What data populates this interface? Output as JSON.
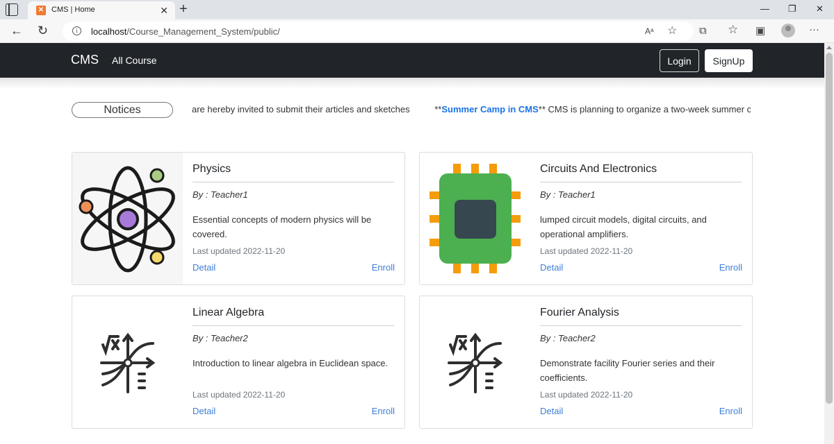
{
  "browser": {
    "tab_title": "CMS | Home",
    "tab_close": "✕",
    "new_tab": "+",
    "url_host": "localhost",
    "url_path": "/Course_Management_System/public/",
    "icons": {
      "back": "←",
      "reload": "↻",
      "info": "i",
      "read_aloud": "Aᵃ",
      "favorite": "☆",
      "extensions": "⧉",
      "favorites_bar": "☆",
      "collections": "▣",
      "more": "···"
    },
    "window": {
      "minimize": "—",
      "restore": "❐",
      "close": "✕"
    }
  },
  "navbar": {
    "brand": "CMS",
    "all_course": "All Course",
    "login": "Login",
    "signup": "SignUp"
  },
  "notices": {
    "label": "Notices",
    "items": [
      {
        "prefix": "",
        "link": "",
        "text": "are hereby invited to submit their articles and sketches"
      },
      {
        "prefix": "**",
        "link": "Summer Camp in CMS",
        "text": "** CMS is planning to organize a two-week summer camp"
      }
    ]
  },
  "courses": [
    {
      "title": "Physics",
      "author": "By : Teacher1",
      "description": "Essential concepts of modern physics will be covered.",
      "updated": "Last updated 2022-11-20",
      "detail": "Detail",
      "enroll": "Enroll",
      "icon": "atom-icon"
    },
    {
      "title": "Circuits And Electronics",
      "author": "By : Teacher1",
      "description": "lumped circuit models, digital circuits, and operational amplifiers.",
      "updated": "Last updated 2022-11-20",
      "detail": "Detail",
      "enroll": "Enroll",
      "icon": "chip-icon"
    },
    {
      "title": "Linear Algebra",
      "author": "By : Teacher2",
      "description": "Introduction to linear algebra in Euclidean space.",
      "updated": "Last updated 2022-11-20",
      "detail": "Detail",
      "enroll": "Enroll",
      "icon": "math-function-icon"
    },
    {
      "title": "Fourier Analysis",
      "author": "By : Teacher2",
      "description": "Demonstrate facility Fourier series and their coefficients.",
      "updated": "Last updated 2022-11-20",
      "detail": "Detail",
      "enroll": "Enroll",
      "icon": "math-function-icon"
    }
  ],
  "colors": {
    "navbar_bg": "#212529",
    "link": "#3d7dd8",
    "notice_link": "#1a73e8",
    "chip_green": "#4caf50",
    "chip_pin": "#f59c0b",
    "chip_core": "#37474f",
    "atom_purple": "#a779d8",
    "atom_orange": "#ef8f58",
    "atom_green": "#a9cc82",
    "atom_yellow": "#f5d96a"
  }
}
